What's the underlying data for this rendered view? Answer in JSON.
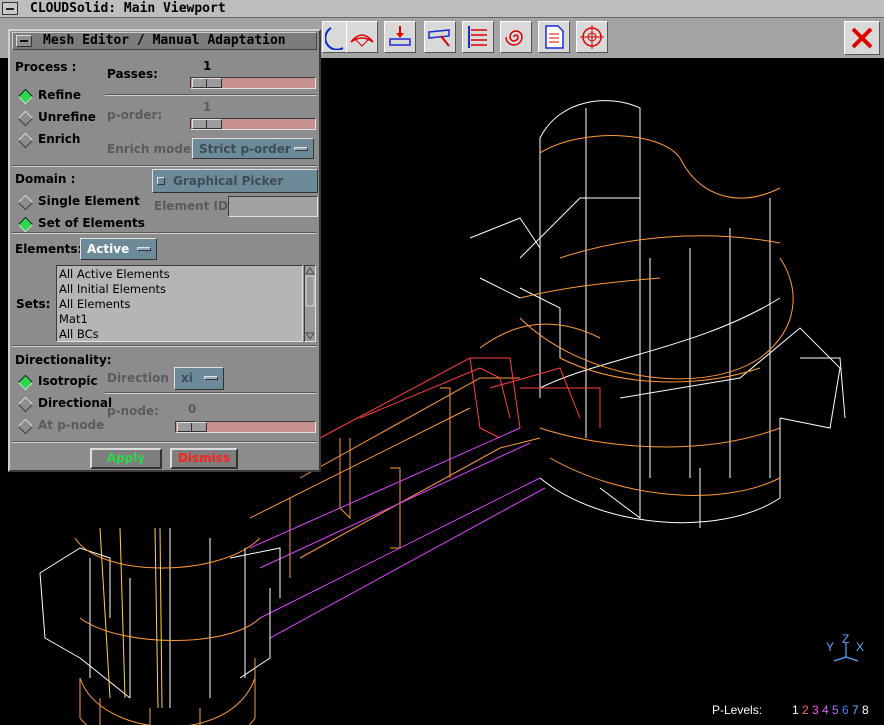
{
  "window": {
    "title": "CLOUDSolid: Main Viewport"
  },
  "toolbar": {
    "buttons": [
      "mesh-refine-tool",
      "element-tool",
      "view-tool",
      "list-tool",
      "shape-tool",
      "pen-tool",
      "move-tool",
      "curve-tool",
      "surface-tool",
      "load-tool",
      "beam-tool",
      "flow-tool",
      "spiral-tool",
      "report-tool",
      "target-tool"
    ],
    "close_icon": "close-icon"
  },
  "dialog": {
    "title": "Mesh Editor / Manual Adaptation",
    "process": {
      "label": "Process :",
      "passes_label": "Passes:",
      "passes_value": "1",
      "passes_fraction": 0.0,
      "options": [
        "Refine",
        "Unrefine",
        "Enrich"
      ],
      "selected": "Refine",
      "p_order_label": "p-order:",
      "p_order_value": "1",
      "enrich_mode_label": "Enrich mode:",
      "enrich_mode_value": "Strict p-order"
    },
    "domain": {
      "label": "Domain :",
      "options": [
        "Single Element",
        "Set of Elements"
      ],
      "selected": "Set of Elements",
      "picker_label": "Graphical Picker",
      "element_id_label": "Element ID:",
      "element_id_value": ""
    },
    "elements": {
      "label": "Elements:",
      "value": "Active",
      "sets_label": "Sets:",
      "sets": [
        "All Active Elements",
        "All Initial Elements",
        "All Elements",
        "Mat1",
        "All BCs"
      ]
    },
    "directionality": {
      "label": "Directionality:",
      "options": [
        "Isotropic",
        "Directional",
        "At p-node"
      ],
      "selected": "Isotropic",
      "direction_label": "Direction :",
      "direction_value": "xi",
      "p_node_label": "p-node:",
      "p_node_value": "0"
    },
    "apply_label": "Apply",
    "dismiss_label": "Dismiss"
  },
  "status": {
    "plevels_label": "P-Levels:",
    "levels": [
      "1",
      "2",
      "3",
      "4",
      "5",
      "6",
      "7",
      "8"
    ],
    "level_colors": [
      "#ffffff",
      "#ff6a6a",
      "#ff55ff",
      "#d25cff",
      "#9a7bff",
      "#4a7dff",
      "#5ab4ff",
      "#ffffff"
    ]
  },
  "colors": {
    "accent_green": "#2ed84b",
    "dismiss_red": "#ff2020",
    "mesh_orange": "#ff9a3c",
    "mesh_white": "#ffffff",
    "mesh_magenta": "#e040ff"
  },
  "axis": {
    "labels": [
      "Y",
      "Z",
      "X"
    ]
  }
}
